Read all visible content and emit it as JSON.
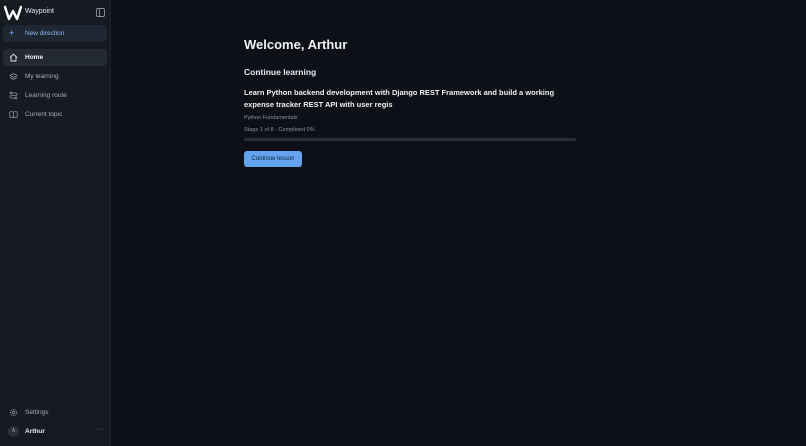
{
  "app": {
    "name": "Waypoint"
  },
  "sidebar": {
    "new_direction_label": "New direction",
    "items": [
      {
        "label": "Home",
        "icon": "home-icon",
        "active": true
      },
      {
        "label": "My learning",
        "icon": "layers-icon",
        "active": false
      },
      {
        "label": "Learning route",
        "icon": "route-icon",
        "active": false
      },
      {
        "label": "Current topic",
        "icon": "book-icon",
        "active": false
      }
    ],
    "settings_label": "Settings",
    "user": {
      "initial": "A",
      "name": "Arthur",
      "menu_label": "···"
    }
  },
  "main": {
    "welcome": "Welcome, Arthur",
    "section_title": "Continue learning",
    "course": {
      "title": "Learn Python backend development with Django REST Framework and build a working expense tracker REST API with user regis",
      "module": "Python Fundamentals",
      "progress_text": "Stage 1 of 8 · Completed 0%",
      "progress_fraction": 0.0
    },
    "continue_button": "Continue lesson"
  },
  "colors": {
    "accent": "#64a4ef",
    "background": "#0d1016",
    "sidebar": "#161a21"
  }
}
